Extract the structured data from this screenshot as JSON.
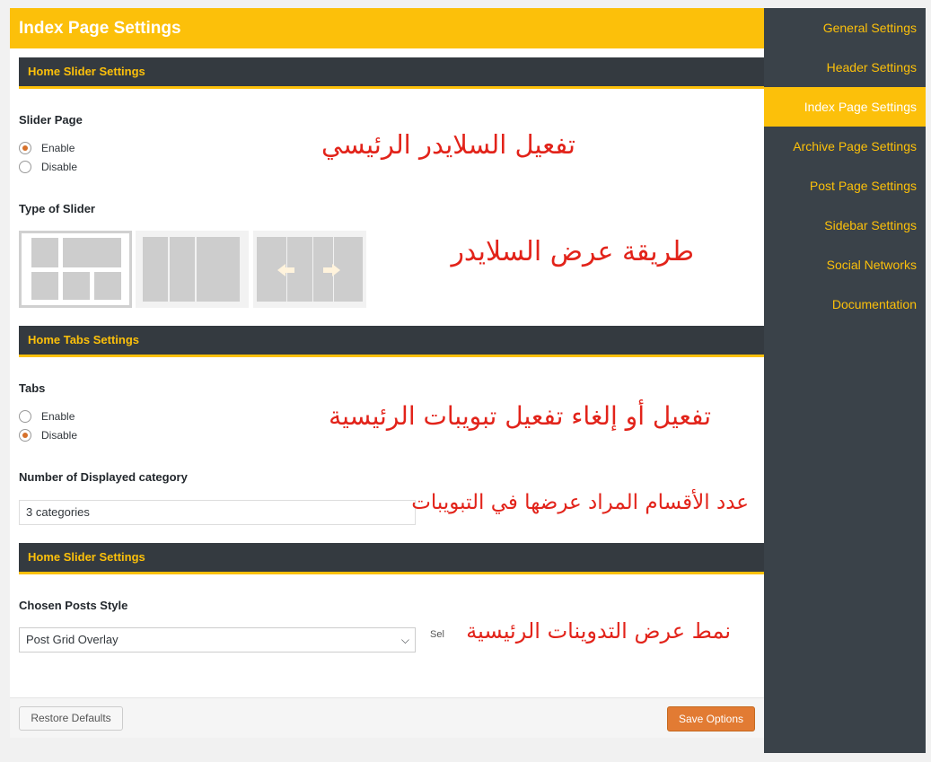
{
  "header": {
    "title": "Index Page Settings"
  },
  "sections": [
    {
      "title": "Home Slider Settings"
    },
    {
      "title": "Home Tabs Settings"
    },
    {
      "title": "Home Slider Settings"
    }
  ],
  "slider_page": {
    "label": "Slider Page",
    "options": [
      "Enable",
      "Disable"
    ],
    "selected": "Enable",
    "annotation": "تفعيل السلايدر الرئيسي"
  },
  "slider_type": {
    "label": "Type of Slider",
    "selected_index": 0,
    "annotation": "طريقة عرض السلايدر"
  },
  "tabs": {
    "label": "Tabs",
    "options": [
      "Enable",
      "Disable"
    ],
    "selected": "Disable",
    "annotation": "تفعيل أو إلغاء تفعيل تبويبات الرئيسية"
  },
  "category_count": {
    "label": "Number of Displayed category",
    "value": "3 categories",
    "annotation": "عدد الأقسام المراد عرضها في التبويبات"
  },
  "posts_style": {
    "label": "Chosen Posts Style",
    "value": "Post Grid Overlay",
    "hint": "Sel",
    "annotation": "نمط عرض التدوينات الرئيسية"
  },
  "footer": {
    "restore_label": "Restore Defaults",
    "save_label": "Save Options"
  },
  "sidebar": {
    "items": [
      {
        "label": "General Settings"
      },
      {
        "label": "Header Settings"
      },
      {
        "label": "Index Page Settings"
      },
      {
        "label": "Archive Page Settings"
      },
      {
        "label": "Post Page Settings"
      },
      {
        "label": "Sidebar Settings"
      },
      {
        "label": "Social Networks"
      },
      {
        "label": "Documentation"
      }
    ],
    "active_index": 2
  },
  "colors": {
    "accent": "#fcc00a",
    "dark": "#343a40",
    "sidebar_bg": "#3a4249",
    "annotation": "#e2231a",
    "save_button": "#e27b33"
  }
}
